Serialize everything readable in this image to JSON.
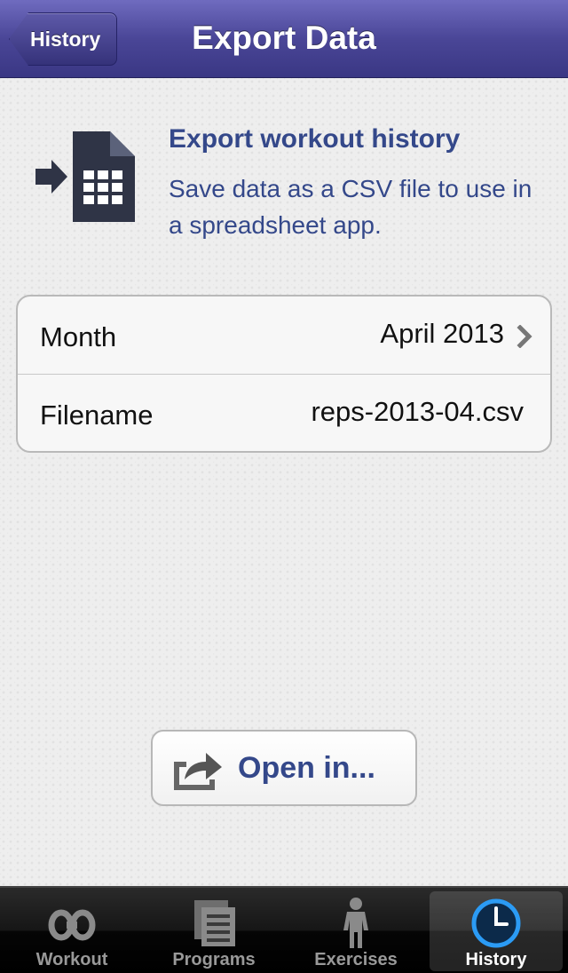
{
  "navbar": {
    "back_label": "History",
    "title": "Export Data"
  },
  "info": {
    "icon": "export-spreadsheet-icon",
    "title": "Export workout history",
    "subtitle": "Save data as a CSV file to use in a spreadsheet app."
  },
  "settings": {
    "month_label": "Month",
    "month_value": "April 2013",
    "filename_label": "Filename",
    "filename_value": "reps-2013-04.csv"
  },
  "open_button": {
    "icon": "share-icon",
    "label": "Open in..."
  },
  "tabbar": {
    "tabs": [
      {
        "label": "Workout",
        "icon": "workout-icon"
      },
      {
        "label": "Programs",
        "icon": "programs-icon"
      },
      {
        "label": "Exercises",
        "icon": "exercises-icon"
      },
      {
        "label": "History",
        "icon": "history-clock-icon"
      }
    ],
    "selected": "History"
  },
  "colors": {
    "accent_text": "#34488a",
    "navbar": "#4a4697",
    "selected_icon": "#1e90ff"
  }
}
